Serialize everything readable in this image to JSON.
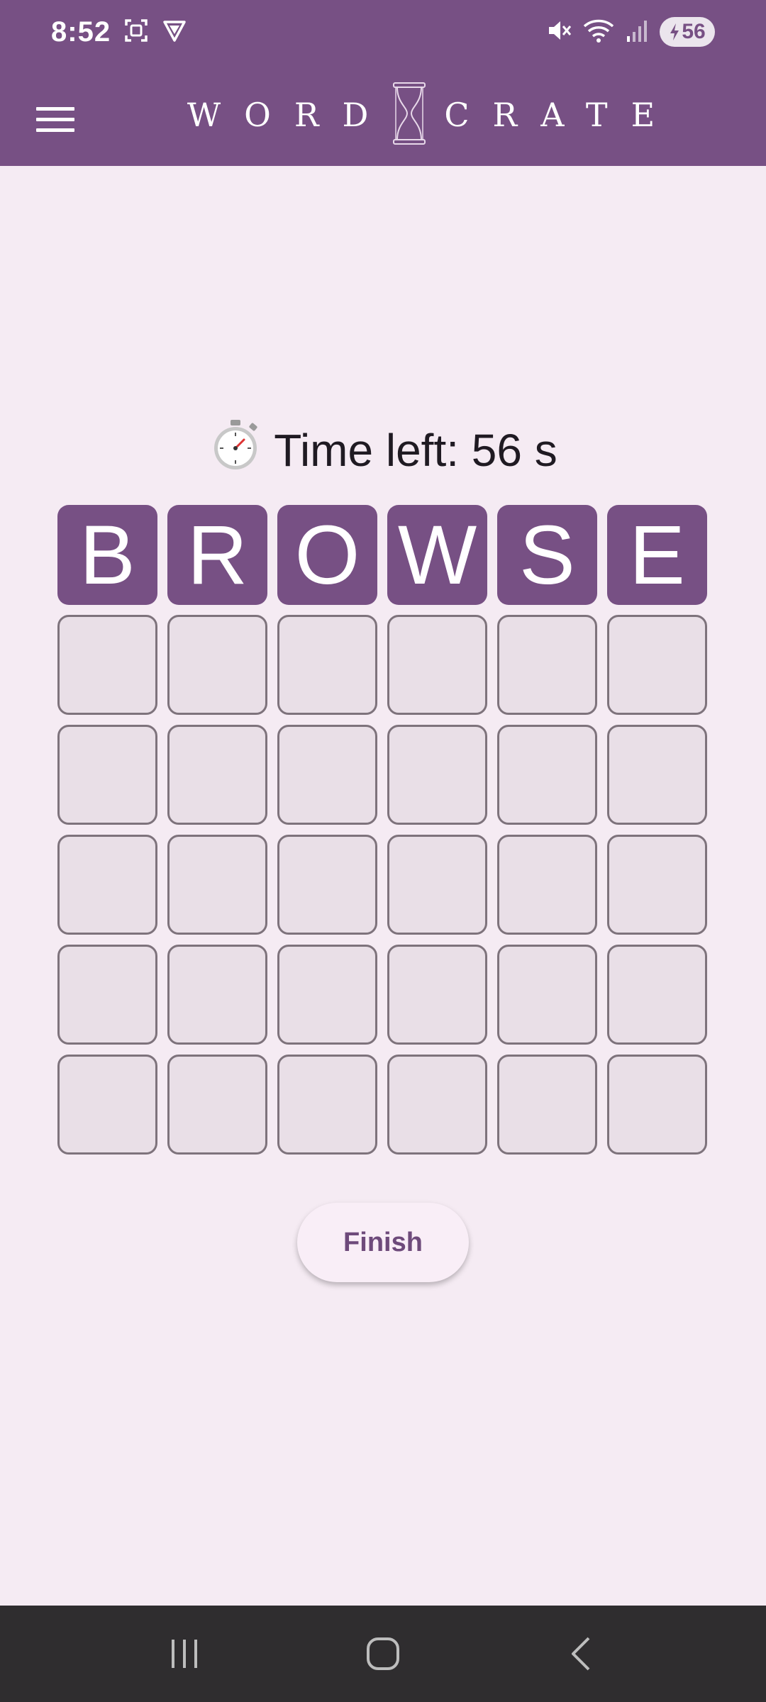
{
  "status_bar": {
    "time": "8:52",
    "battery_level": "56",
    "icons": [
      "screenshot-icon",
      "vpn-shield-icon",
      "mute-icon",
      "wifi-icon",
      "signal-icon",
      "battery-charging-icon"
    ]
  },
  "app_bar": {
    "logo_left": "WORD",
    "logo_right": "CRATE",
    "menu_icon": "hamburger-menu-icon",
    "logo_icon": "hourglass-icon"
  },
  "timer": {
    "icon": "stopwatch-icon",
    "text": "Time left: 56 s"
  },
  "grid": {
    "rows": [
      [
        "B",
        "R",
        "O",
        "W",
        "S",
        "E"
      ],
      [
        "",
        "",
        "",
        "",
        "",
        ""
      ],
      [
        "",
        "",
        "",
        "",
        "",
        ""
      ],
      [
        "",
        "",
        "",
        "",
        "",
        ""
      ],
      [
        "",
        "",
        "",
        "",
        "",
        ""
      ],
      [
        "",
        "",
        "",
        "",
        "",
        ""
      ]
    ]
  },
  "actions": {
    "finish_label": "Finish"
  },
  "nav_bar": {
    "icons": [
      "recent-apps-icon",
      "home-icon",
      "back-icon"
    ]
  },
  "colors": {
    "primary": "#775084",
    "background": "#f5ebf3",
    "tile_empty": "#e9dfe7",
    "tile_border": "#7e737c",
    "nav_bar": "#2f2d2f"
  }
}
